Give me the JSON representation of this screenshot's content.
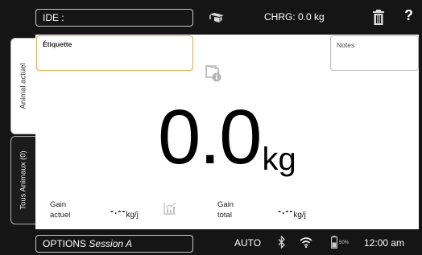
{
  "header": {
    "ide_label": "IDE :",
    "charge_text": "CHRG: 0.0 kg",
    "help_label": "?"
  },
  "tabs": [
    {
      "label": "Animal actuel",
      "active": true
    },
    {
      "label": "Tous Animaux (0)",
      "active": false
    }
  ],
  "main": {
    "etiquette_label": "Étiquette",
    "notes_label": "Notes",
    "weight_value": "0.0",
    "weight_unit": "kg",
    "gain_current": {
      "label_line1": "Gain",
      "label_line2": "actuel",
      "value": "-.--",
      "unit": "kg/j"
    },
    "gain_total": {
      "label_line1": "Gain",
      "label_line2": "total",
      "value": "-.--",
      "unit": "kg/j"
    }
  },
  "footer": {
    "options_label": "OPTIONS",
    "session_label": "Session A",
    "mode": "AUTO",
    "battery_percent": "50%",
    "time": "12:00 am"
  },
  "colors": {
    "bar_bg": "#151515",
    "etiquette_border": "#d8ab55"
  },
  "icons": [
    "trainer-icon",
    "trash-icon",
    "help-icon",
    "tag-info-icon",
    "graph-icon",
    "bluetooth-icon",
    "wifi-icon",
    "battery-icon"
  ]
}
